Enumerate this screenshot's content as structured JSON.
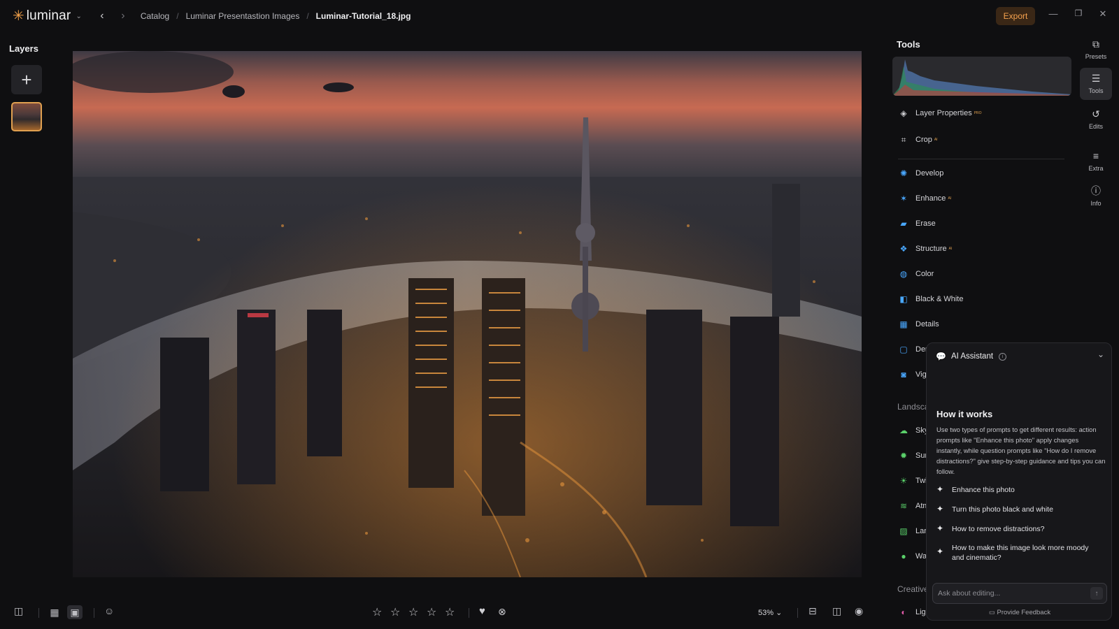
{
  "app": {
    "name": "luminar",
    "accent": "#f2a14a"
  },
  "breadcrumb": [
    "Catalog",
    "Luminar Presentastion Images",
    "Luminar-Tutorial_18.jpg"
  ],
  "toolbar": {
    "export_label": "Export"
  },
  "layers": {
    "title": "Layers"
  },
  "tools": {
    "title": "Tools",
    "items": [
      {
        "label": "Layer Properties",
        "badge": "PRO",
        "icon": "layers-icon"
      },
      {
        "label": "Crop",
        "badge": "AI",
        "icon": "crop-icon"
      },
      {
        "label": "Develop",
        "badge": "",
        "icon": "sun-icon"
      },
      {
        "label": "Enhance",
        "badge": "AI",
        "icon": "sparkle-icon"
      },
      {
        "label": "Erase",
        "badge": "",
        "icon": "eraser-icon"
      },
      {
        "label": "Structure",
        "badge": "AI",
        "icon": "structure-icon"
      },
      {
        "label": "Color",
        "badge": "",
        "icon": "color-icon"
      },
      {
        "label": "Black & White",
        "badge": "",
        "icon": "bw-icon"
      },
      {
        "label": "Details",
        "badge": "",
        "icon": "details-icon"
      },
      {
        "label": "Den",
        "badge": "",
        "icon": "denoise-icon"
      },
      {
        "label": "Vign",
        "badge": "",
        "icon": "vignette-icon"
      }
    ],
    "section_landscape": "Landsca",
    "landscape_items": [
      {
        "label": "Sky",
        "icon": "cloud-icon"
      },
      {
        "label": "Sun",
        "icon": "sunrays-icon"
      },
      {
        "label": "Twil",
        "icon": "twilight-icon"
      },
      {
        "label": "Atm",
        "icon": "atmosphere-icon"
      },
      {
        "label": "Lanc",
        "icon": "landscape-icon"
      },
      {
        "label": "Wat",
        "icon": "water-icon"
      }
    ],
    "section_creative": "Creative",
    "creative_items": [
      {
        "label": "Ligh",
        "icon": "light-icon"
      }
    ]
  },
  "rail": [
    {
      "label": "Presets",
      "icon": "presets-icon"
    },
    {
      "label": "Tools",
      "icon": "sliders-icon"
    },
    {
      "label": "Edits",
      "icon": "history-icon"
    },
    {
      "label": "Extra",
      "icon": "list-icon"
    },
    {
      "label": "Info",
      "icon": "info-icon"
    }
  ],
  "ai": {
    "title": "AI Assistant",
    "how_title": "How it works",
    "how_text": "Use two types of prompts to get different results: action prompts like \"Enhance this photo\" apply changes instantly, while question prompts like \"How do I remove distractions?\" give step-by-step guidance and tips you can follow.",
    "prompts": [
      "Enhance this photo",
      "Turn this photo black and white",
      "How to remove distractions?",
      "How to make this image look more moody and cinematic?"
    ],
    "input_placeholder": "Ask about editing...",
    "feedback": "Provide Feedback"
  },
  "bottom": {
    "zoom": "53%"
  }
}
